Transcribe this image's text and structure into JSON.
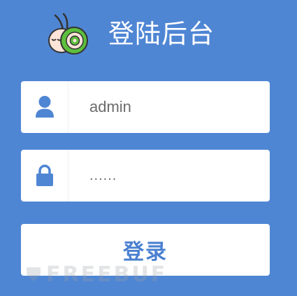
{
  "header": {
    "title": "登陆后台",
    "logo_icon": "snail-logo-icon"
  },
  "form": {
    "username": {
      "icon": "user-icon",
      "value": "admin"
    },
    "password": {
      "icon": "lock-icon",
      "value": "......"
    },
    "login_button_label": "登录"
  },
  "watermark": {
    "text": "FREEBUF",
    "icon": "freebuf-watermark-icon"
  },
  "colors": {
    "background": "#4f86d4",
    "button_text": "#4a80d0",
    "icon": "#4f86d4"
  }
}
